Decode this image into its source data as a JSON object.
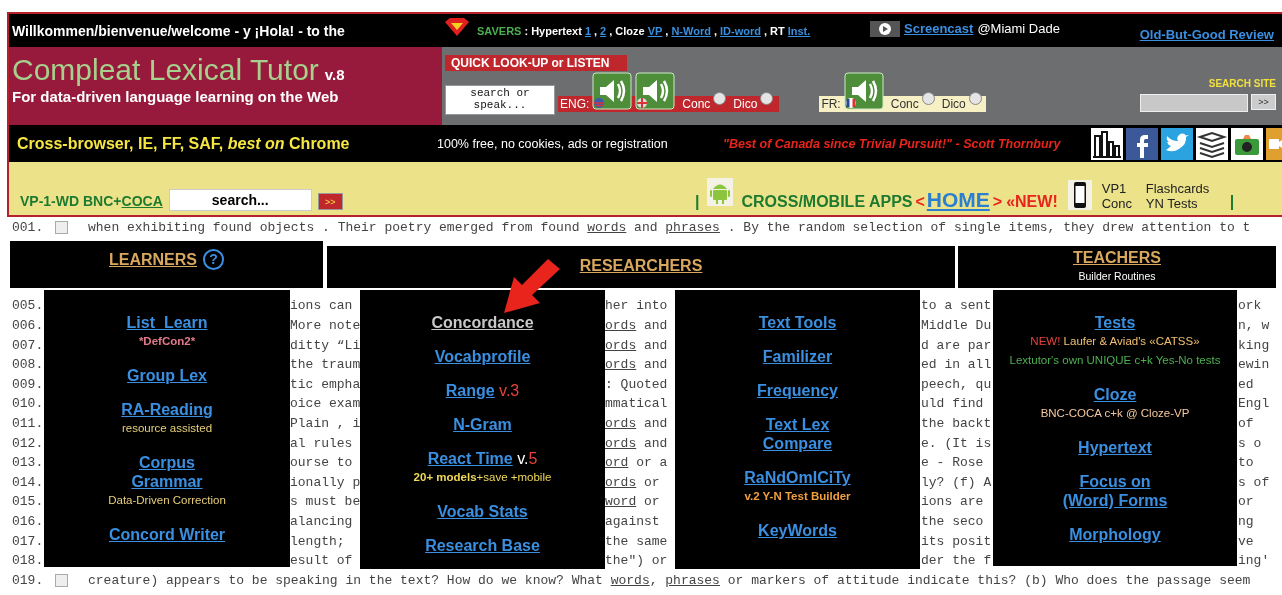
{
  "header": {
    "welcome": "Willkommen/bienvenue/welcome - y ¡Hola! - to the",
    "savers": {
      "label": "SAVERS",
      "parts": [
        {
          "text": ": Hypertext",
          "kind": "label"
        },
        {
          "text": "1",
          "kind": "link"
        },
        {
          "text": ",",
          "kind": "label"
        },
        {
          "text": "2",
          "kind": "link"
        },
        {
          "text": ", Cloze",
          "kind": "label"
        },
        {
          "text": "VP",
          "kind": "link"
        },
        {
          "text": ",",
          "kind": "label"
        },
        {
          "text": "N-Word",
          "kind": "link"
        },
        {
          "text": ",",
          "kind": "label"
        },
        {
          "text": "ID-word",
          "kind": "link"
        },
        {
          "text": ", RT",
          "kind": "label"
        },
        {
          "text": "Inst.",
          "kind": "link"
        }
      ]
    },
    "screencast": {
      "link": "Screencast",
      "note": "@Miami Dade"
    },
    "review_link": "Old-But-Good Review"
  },
  "brand": {
    "title": "Compleat Lexical Tutor",
    "version": "v.8",
    "tagline": "For data-driven language learning on the Web"
  },
  "lookup": {
    "title": "QUICK LOOK-UP or LISTEN",
    "placeholder": "search or speak...",
    "languages": [
      {
        "label": "ENG:",
        "color": "#c0272d",
        "options": [
          {
            "label": "Conc",
            "checked": false
          },
          {
            "label": "Dico",
            "checked": false
          }
        ]
      },
      {
        "label": "FR:",
        "color": "#f6f0c4",
        "options": [
          {
            "label": "Conc",
            "checked": false
          },
          {
            "label": "Dico",
            "checked": false
          }
        ]
      }
    ]
  },
  "site_search": {
    "label": "SEARCH SITE",
    "button": ">>"
  },
  "promo": {
    "compat": "Cross-browser, IE, FF, SAF, *best on* Chrome",
    "free": "100% free, no cookies, ads or registration",
    "quote": "\"Best of Canada since Trivial Pursuit!\" - Scott Thornbury"
  },
  "toolbar": {
    "label": "VP-1-WD BNC+",
    "link": "COCA",
    "search_value": "search...",
    "button": ">>",
    "separators": [
      "|",
      "|"
    ],
    "apps": "CROSS/MOBILE APPS",
    "open": "<",
    "home": "HOME",
    "close": ">",
    "new": "«NEW!",
    "grid": [
      "VP1",
      "Flashcards",
      "Conc",
      "YN Tests"
    ]
  },
  "lines": [
    {
      "number": "001.",
      "kind": "full",
      "checked": false,
      "segments": [
        [
          {
            "text": "when exhibiting found objects . Their poetry emerged from found ",
            "link": false
          },
          {
            "text": "words",
            "link": true
          },
          {
            "text": " and ",
            "link": false
          },
          {
            "text": "phrases",
            "link": true
          },
          {
            "text": " . By the random selection of single items, they drew attention to t",
            "link": false
          }
        ]
      ]
    },
    {
      "number": "005.",
      "kind": "fragments",
      "segments": [
        [
          {
            "text": "ions can",
            "link": false
          }
        ],
        [
          {
            "text": "her into",
            "link": false
          }
        ],
        [
          {
            "text": "to a sent",
            "link": false
          }
        ],
        [
          {
            "text": "ork",
            "link": false
          }
        ]
      ]
    },
    {
      "number": "006.",
      "kind": "fragments",
      "segments": [
        [
          {
            "text": "More note",
            "link": false
          }
        ],
        [
          {
            "text": "ords",
            "link": true
          },
          {
            "text": " and",
            "link": false
          }
        ],
        [
          {
            "text": "Middle Du",
            "link": false
          }
        ],
        [
          {
            "text": "n, w",
            "link": false
          }
        ]
      ]
    },
    {
      "number": "007.",
      "kind": "fragments",
      "segments": [
        [
          {
            "text": "ditty “Li",
            "link": false
          }
        ],
        [
          {
            "text": "ords",
            "link": true
          },
          {
            "text": " and",
            "link": false
          }
        ],
        [
          {
            "text": "d are par",
            "link": false
          }
        ],
        [
          {
            "text": "king",
            "link": false
          }
        ]
      ]
    },
    {
      "number": "008.",
      "kind": "fragments",
      "segments": [
        [
          {
            "text": "the traum",
            "link": false
          }
        ],
        [
          {
            "text": "ords",
            "link": true
          },
          {
            "text": " and",
            "link": false
          }
        ],
        [
          {
            "text": "ed in all",
            "link": false
          }
        ],
        [
          {
            "text": "ewin",
            "link": false
          }
        ]
      ]
    },
    {
      "number": "009.",
      "kind": "fragments",
      "segments": [
        [
          {
            "text": "tic empha",
            "link": false
          }
        ],
        [
          {
            "text": ": Quoted",
            "link": false
          }
        ],
        [
          {
            "text": "peech, qu",
            "link": false
          }
        ],
        [
          {
            "text": "ed",
            "link": false
          }
        ]
      ]
    },
    {
      "number": "010.",
      "kind": "fragments",
      "segments": [
        [
          {
            "text": "oice exam",
            "link": false
          }
        ],
        [
          {
            "text": "mmatical",
            "link": false
          }
        ],
        [
          {
            "text": "uld find",
            "link": false
          }
        ],
        [
          {
            "text": "Engl",
            "link": false
          }
        ]
      ]
    },
    {
      "number": "011.",
      "kind": "fragments",
      "segments": [
        [
          {
            "text": "Plain , i",
            "link": false
          }
        ],
        [
          {
            "text": "ords",
            "link": true
          },
          {
            "text": " and",
            "link": false
          }
        ],
        [
          {
            "text": "the backt",
            "link": false
          }
        ],
        [
          {
            "text": "of",
            "link": false
          }
        ]
      ]
    },
    {
      "number": "012.",
      "kind": "fragments",
      "segments": [
        [
          {
            "text": "al rules",
            "link": false
          }
        ],
        [
          {
            "text": "ords",
            "link": true
          },
          {
            "text": " and",
            "link": false
          }
        ],
        [
          {
            "text": "e. (It is",
            "link": false
          }
        ],
        [
          {
            "text": "s o",
            "link": false
          }
        ]
      ]
    },
    {
      "number": "013.",
      "kind": "fragments",
      "segments": [
        [
          {
            "text": "ourse to",
            "link": false
          }
        ],
        [
          {
            "text": "ord",
            "link": true
          },
          {
            "text": " or a",
            "link": false
          }
        ],
        [
          {
            "text": "e - Rose",
            "link": false
          }
        ],
        [
          {
            "text": "to",
            "link": false
          }
        ]
      ]
    },
    {
      "number": "014.",
      "kind": "fragments",
      "segments": [
        [
          {
            "text": "ionally p",
            "link": false
          }
        ],
        [
          {
            "text": "ords",
            "link": true
          },
          {
            "text": " or",
            "link": false
          }
        ],
        [
          {
            "text": "ly? (f) A",
            "link": false
          }
        ],
        [
          {
            "text": "s of",
            "link": false
          }
        ]
      ]
    },
    {
      "number": "015.",
      "kind": "fragments",
      "segments": [
        [
          {
            "text": "s must be",
            "link": false
          }
        ],
        [
          {
            "text": "word",
            "link": true
          },
          {
            "text": " or",
            "link": false
          }
        ],
        [
          {
            "text": "ions are",
            "link": false
          }
        ],
        [
          {
            "text": "or",
            "link": false
          }
        ]
      ]
    },
    {
      "number": "016.",
      "kind": "fragments",
      "segments": [
        [
          {
            "text": "alancing",
            "link": false
          }
        ],
        [
          {
            "text": "against",
            "link": false
          }
        ],
        [
          {
            "text": "the seco",
            "link": false
          }
        ],
        [
          {
            "text": "ng",
            "link": false
          }
        ]
      ]
    },
    {
      "number": "017.",
      "kind": "fragments",
      "segments": [
        [
          {
            "text": "length;",
            "link": false
          }
        ],
        [
          {
            "text": "the same",
            "link": false
          }
        ],
        [
          {
            "text": "its posit",
            "link": false
          }
        ],
        [
          {
            "text": "ve",
            "link": false
          }
        ]
      ]
    },
    {
      "number": "018.",
      "kind": "fragments",
      "segments": [
        [
          {
            "text": "esult of",
            "link": false
          }
        ],
        [
          {
            "text": "the\") or",
            "link": false
          }
        ],
        [
          {
            "text": "der the f",
            "link": false
          }
        ],
        [
          {
            "text": "ing'",
            "link": false
          }
        ]
      ]
    },
    {
      "number": "019.",
      "kind": "full",
      "checked": false,
      "segments": [
        [
          {
            "text": "creature) appears to be speaking in the text? How do we know? What ",
            "link": false
          },
          {
            "text": "words",
            "link": true
          },
          {
            "text": ", ",
            "link": false
          },
          {
            "text": "phrases",
            "link": true
          },
          {
            "text": " or markers of attitude indicate this? (b) Who does the passage seem",
            "link": false
          }
        ]
      ]
    }
  ],
  "sections": [
    {
      "title": "LEARNERS",
      "help": "?"
    },
    {
      "title": "RESEARCHERS"
    },
    {
      "title": "TEACHERS",
      "subtitle": "Builder Routines"
    }
  ],
  "panels": [
    {
      "items": [
        {
          "link": "List_Learn",
          "visited": false,
          "notes": [
            [
              {
                "text": "*DefCon2*",
                "color": "#e27a8c",
                "bold": true
              }
            ]
          ]
        },
        {
          "link": "Group Lex",
          "visited": false
        },
        {
          "link": "RA-Reading",
          "visited": false,
          "notes": [
            [
              {
                "text": "resource assisted",
                "color": "#e8cf7a",
                "bold": false
              }
            ]
          ]
        },
        {
          "link": "Corpus\nGrammar",
          "visited": false,
          "notes": [
            [
              {
                "text": "Data-Driven Correction",
                "color": "#e8cf7a",
                "bold": false
              }
            ]
          ]
        },
        {
          "link": "Concord Writer",
          "visited": false
        }
      ]
    },
    {
      "items": [
        {
          "link": "Concordance",
          "visited": true
        },
        {
          "link": "Vocabprofile",
          "visited": false
        },
        {
          "link": "Range",
          "visited": false,
          "after": [
            {
              "text": " v.3",
              "color": "#e8413c"
            }
          ]
        },
        {
          "link": "N-Gram",
          "visited": false
        },
        {
          "link": "React Time",
          "visited": false,
          "after": [
            {
              "text": " v.",
              "color": "#ffffff"
            },
            {
              "text": "5",
              "color": "#e8413c"
            }
          ],
          "notes": [
            [
              {
                "text": "20+ models",
                "color": "#f0d85a",
                "bold": true
              },
              {
                "text": "+save +mobile",
                "color": "#f0d85a",
                "bold": false
              }
            ]
          ]
        },
        {
          "link": "Vocab Stats",
          "visited": false
        },
        {
          "link": "Research Base",
          "visited": false
        }
      ]
    },
    {
      "items": [
        {
          "link": "Text Tools",
          "visited": false
        },
        {
          "link": "Familizer",
          "visited": false
        },
        {
          "link": "Frequency",
          "visited": false
        },
        {
          "link": "Text Lex\nCompare",
          "visited": false
        },
        {
          "link": "RaNdOmICiTy",
          "visited": false,
          "notes": [
            [
              {
                "text": "v.2 Y-N Test Builder",
                "color": "#f0a040",
                "bold": true
              }
            ]
          ]
        },
        {
          "link": "KeyWords",
          "visited": false
        }
      ]
    },
    {
      "items": [
        {
          "link": "Tests",
          "visited": false,
          "notes": [
            [
              {
                "text": "NEW!",
                "color": "#e8413c",
                "bold": false
              },
              {
                "text": " Laufer & Aviad's «CATSS»",
                "color": "#f0c070",
                "bold": false
              }
            ],
            [
              {
                "text": "Lextutor's own UNIQUE c+k Yes-No tests",
                "color": "#4caf50",
                "bold": false
              }
            ]
          ]
        },
        {
          "link": "Cloze",
          "visited": false,
          "notes": [
            [
              {
                "text": "BNC-COCA c+k @ Cloze-VP",
                "color": "#f5c9a0",
                "bold": false
              }
            ]
          ]
        },
        {
          "link": "Hypertext",
          "visited": false
        },
        {
          "link": "Focus on\n(Word) Forms",
          "visited": false
        },
        {
          "link": "Morphology",
          "visited": false
        }
      ]
    }
  ]
}
